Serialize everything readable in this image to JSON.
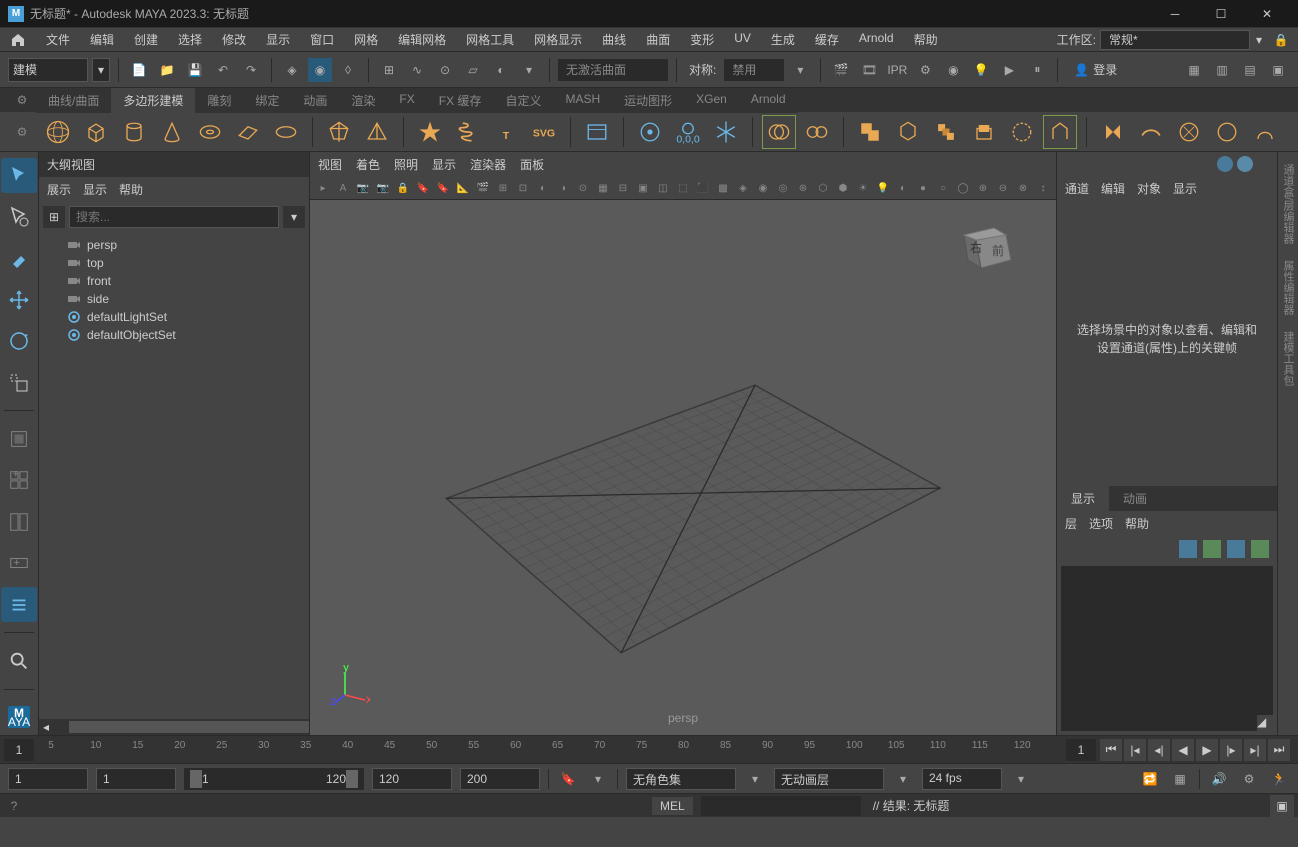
{
  "titlebar": {
    "title": "无标题* - Autodesk MAYA 2023.3: 无标题",
    "app_icon": "M"
  },
  "menubar": {
    "items": [
      "文件",
      "编辑",
      "创建",
      "选择",
      "修改",
      "显示",
      "窗口",
      "网格",
      "编辑网格",
      "网格工具",
      "网格显示",
      "曲线",
      "曲面",
      "变形",
      "UV",
      "生成",
      "缓存",
      "Arnold",
      "帮助"
    ],
    "workspace_label": "工作区:",
    "workspace_value": "常规*"
  },
  "toolbar1": {
    "mode": "建模",
    "curve_status": "无激活曲面",
    "sym_label": "对称:",
    "sym_value": "禁用",
    "login": "登录"
  },
  "shelftabs": [
    "曲线/曲面",
    "多边形建模",
    "雕刻",
    "绑定",
    "动画",
    "渲染",
    "FX",
    "FX 缓存",
    "自定义",
    "MASH",
    "运动图形",
    "XGen",
    "Arnold"
  ],
  "shelf_active": 1,
  "outliner": {
    "title": "大纲视图",
    "menu": [
      "展示",
      "显示",
      "帮助"
    ],
    "search_placeholder": "搜索...",
    "items": [
      {
        "icon": "camera",
        "label": "persp"
      },
      {
        "icon": "camera",
        "label": "top"
      },
      {
        "icon": "camera",
        "label": "front"
      },
      {
        "icon": "camera",
        "label": "side"
      },
      {
        "icon": "set",
        "label": "defaultLightSet"
      },
      {
        "icon": "set",
        "label": "defaultObjectSet"
      }
    ]
  },
  "viewport": {
    "menu": [
      "视图",
      "着色",
      "照明",
      "显示",
      "渲染器",
      "面板"
    ],
    "camera": "persp",
    "cube_front": "前",
    "cube_right": "右"
  },
  "channelbox": {
    "menu": [
      "通道",
      "编辑",
      "对象",
      "显示"
    ],
    "empty_msg": "选择场景中的对象以查看、编辑和设置通道(属性)上的关键帧",
    "layer_tabs": [
      "显示",
      "动画"
    ],
    "layer_menu": [
      "层",
      "选项",
      "帮助"
    ]
  },
  "sidebar_r": [
    "通道盒/层编辑器",
    "属性编辑器",
    "建模工具包"
  ],
  "timeslider": {
    "current": "1",
    "ticks": [
      "5",
      "10",
      "15",
      "20",
      "25",
      "30",
      "35",
      "40",
      "45",
      "50",
      "55",
      "60",
      "65",
      "70",
      "75",
      "80",
      "85",
      "90",
      "95",
      "100",
      "105",
      "110",
      "115",
      "120"
    ],
    "endframe": "1"
  },
  "rangeslider": {
    "start": "1",
    "range_start": "1",
    "range_in": "1",
    "range_out": "120",
    "playback_start": "120",
    "playback_end": "200",
    "charset": "无角色集",
    "animlayer": "无动画层",
    "fps": "24 fps"
  },
  "cmdline": {
    "lang": "MEL",
    "result": "// 结果: 无标题"
  }
}
